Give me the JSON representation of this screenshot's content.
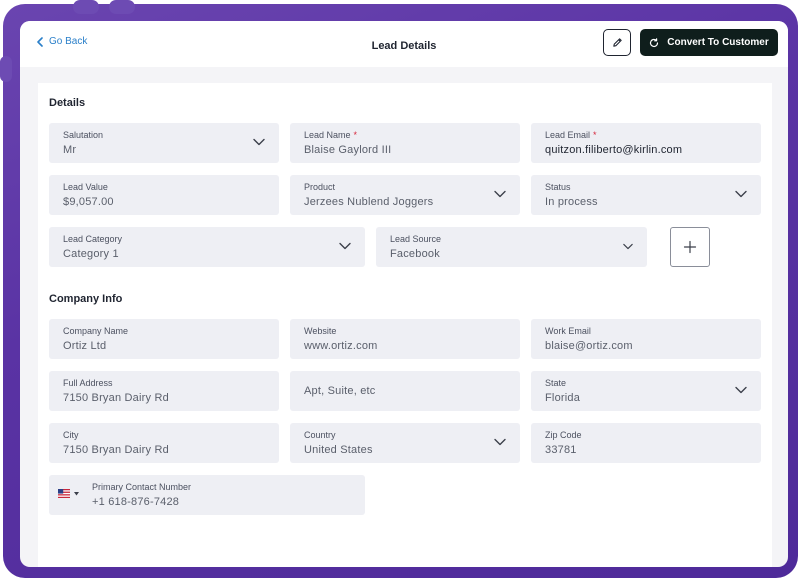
{
  "header": {
    "back_label": "Go Back",
    "title": "Lead Details",
    "convert_label": "Convert To Customer"
  },
  "details": {
    "section_title": "Details",
    "salutation": {
      "label": "Salutation",
      "value": "Mr"
    },
    "lead_name": {
      "label": "Lead Name",
      "required": "*",
      "value": "Blaise Gaylord III"
    },
    "lead_email": {
      "label": "Lead Email",
      "required": "*",
      "value": "quitzon.filiberto@kirlin.com"
    },
    "lead_value": {
      "label": "Lead Value",
      "value": "$9,057.00"
    },
    "product": {
      "label": "Product",
      "value": "Jerzees Nublend Joggers"
    },
    "status": {
      "label": "Status",
      "value": "In process"
    },
    "lead_category": {
      "label": "Lead Category",
      "value": "Category 1"
    },
    "lead_source": {
      "label": "Lead Source",
      "value": "Facebook"
    }
  },
  "company": {
    "section_title": "Company Info",
    "company_name": {
      "label": "Company Name",
      "value": "Ortiz Ltd"
    },
    "website": {
      "label": "Website",
      "value": "www.ortiz.com"
    },
    "work_email": {
      "label": "Work Email",
      "value": "blaise@ortiz.com"
    },
    "full_address": {
      "label": "Full Address",
      "value": "7150 Bryan Dairy Rd"
    },
    "apt": {
      "placeholder": "Apt, Suite, etc"
    },
    "state": {
      "label": "State",
      "value": "Florida"
    },
    "city": {
      "label": "City",
      "value": "7150 Bryan Dairy Rd"
    },
    "country": {
      "label": "Country",
      "value": "United States"
    },
    "zip": {
      "label": "Zip Code",
      "value": "33781"
    },
    "phone": {
      "label": "Primary Contact Number",
      "value": "+1 618-876-7428"
    }
  },
  "icons": {
    "back": "chevron-left-icon",
    "edit": "pencil-icon",
    "convert": "refresh-icon",
    "dropdown": "chevron-down-icon",
    "add": "plus-icon",
    "flag": "us-flag-icon"
  },
  "colors": {
    "frame": "#5a33a4",
    "link": "#2a7fc9",
    "primary_button": "#0f1e1c",
    "field_bg": "#eeeff4",
    "required": "#d6253a"
  }
}
